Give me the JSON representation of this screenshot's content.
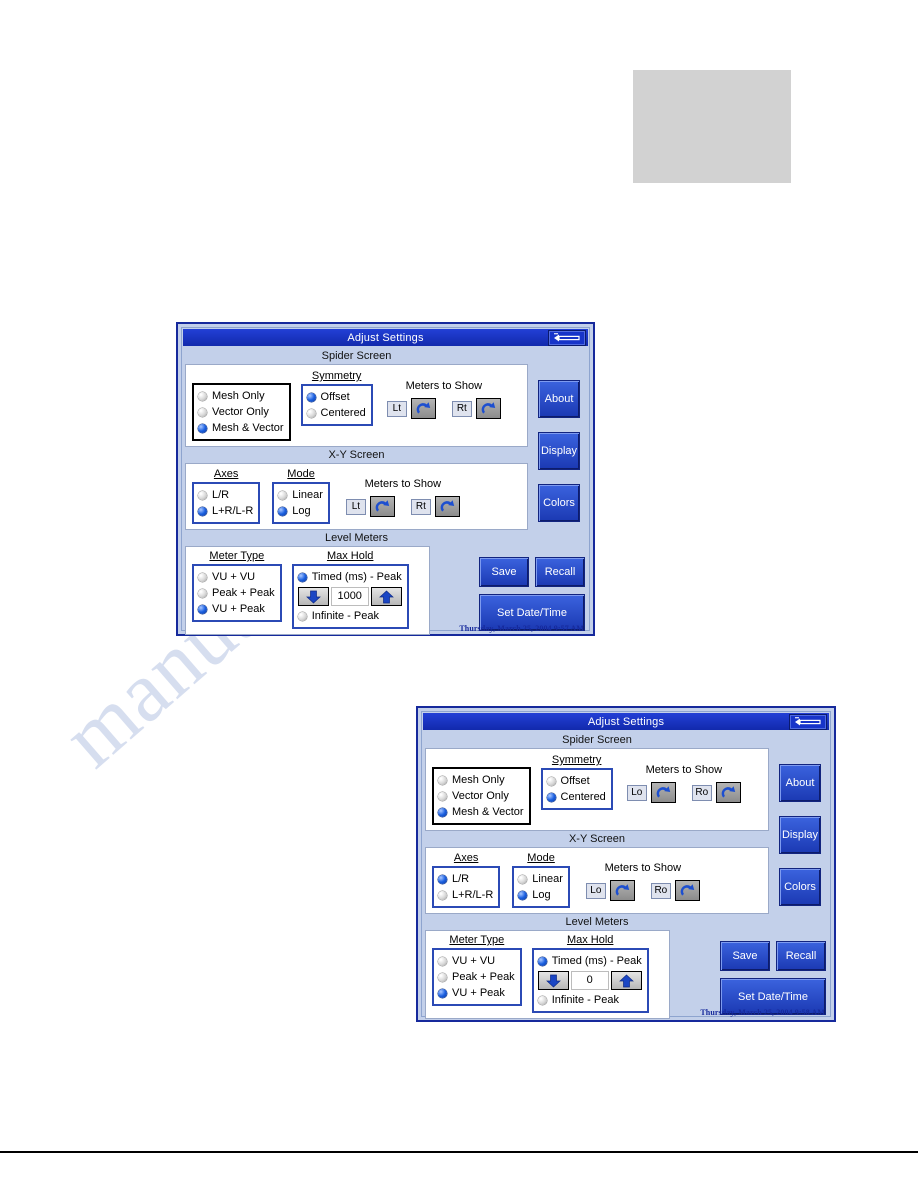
{
  "page": {
    "watermark_text": "manualshive.com"
  },
  "dialogs": [
    {
      "id": "dialog-1",
      "title": "Adjust Settings",
      "close_icon": "back-arrow-icon",
      "sections": {
        "spider": {
          "label": "Spider Screen",
          "display_group": {
            "options": [
              {
                "label": "Mesh Only",
                "selected": false
              },
              {
                "label": "Vector Only",
                "selected": false
              },
              {
                "label": "Mesh & Vector",
                "selected": true
              }
            ]
          },
          "symmetry_group": {
            "title": "Symmetry",
            "options": [
              {
                "label": "Offset",
                "selected": true
              },
              {
                "label": "Centered",
                "selected": false
              }
            ]
          },
          "meters": {
            "title": "Meters to Show",
            "left_label": "Lt",
            "right_label": "Rt"
          }
        },
        "xy": {
          "label": "X-Y Screen",
          "axes_group": {
            "title": "Axes",
            "options": [
              {
                "label": "L/R",
                "selected": false
              },
              {
                "label": "L+R/L-R",
                "selected": true
              }
            ]
          },
          "mode_group": {
            "title": "Mode",
            "options": [
              {
                "label": "Linear",
                "selected": false
              },
              {
                "label": "Log",
                "selected": true
              }
            ]
          },
          "meters": {
            "title": "Meters to Show",
            "left_label": "Lt",
            "right_label": "Rt"
          }
        },
        "level": {
          "label": "Level Meters",
          "meter_type_group": {
            "title": "Meter Type",
            "options": [
              {
                "label": "VU + VU",
                "selected": false
              },
              {
                "label": "Peak + Peak",
                "selected": false
              },
              {
                "label": "VU + Peak",
                "selected": true
              }
            ]
          },
          "max_hold_group": {
            "title": "Max Hold",
            "timed_label": "Timed (ms) - Peak",
            "timed_selected": true,
            "value": "1000",
            "infinite_label": "Infinite - Peak",
            "infinite_selected": false
          }
        }
      },
      "side_buttons": {
        "about": "About",
        "display": "Display",
        "colors": "Colors"
      },
      "action_buttons": {
        "save": "Save",
        "recall": "Recall",
        "set_datetime": "Set Date/Time"
      },
      "timestamp": "Thursday, March 25, 2004  9:57 AM"
    },
    {
      "id": "dialog-2",
      "title": "Adjust Settings",
      "close_icon": "back-arrow-icon",
      "sections": {
        "spider": {
          "label": "Spider Screen",
          "display_group": {
            "options": [
              {
                "label": "Mesh Only",
                "selected": false
              },
              {
                "label": "Vector Only",
                "selected": false
              },
              {
                "label": "Mesh & Vector",
                "selected": true
              }
            ]
          },
          "symmetry_group": {
            "title": "Symmetry",
            "options": [
              {
                "label": "Offset",
                "selected": false
              },
              {
                "label": "Centered",
                "selected": true
              }
            ]
          },
          "meters": {
            "title": "Meters to Show",
            "left_label": "Lo",
            "right_label": "Ro"
          }
        },
        "xy": {
          "label": "X-Y Screen",
          "axes_group": {
            "title": "Axes",
            "options": [
              {
                "label": "L/R",
                "selected": true
              },
              {
                "label": "L+R/L-R",
                "selected": false
              }
            ]
          },
          "mode_group": {
            "title": "Mode",
            "options": [
              {
                "label": "Linear",
                "selected": false
              },
              {
                "label": "Log",
                "selected": true
              }
            ]
          },
          "meters": {
            "title": "Meters to Show",
            "left_label": "Lo",
            "right_label": "Ro"
          }
        },
        "level": {
          "label": "Level Meters",
          "meter_type_group": {
            "title": "Meter Type",
            "options": [
              {
                "label": "VU + VU",
                "selected": false
              },
              {
                "label": "Peak + Peak",
                "selected": false
              },
              {
                "label": "VU + Peak",
                "selected": true
              }
            ]
          },
          "max_hold_group": {
            "title": "Max Hold",
            "timed_label": "Timed (ms) - Peak",
            "timed_selected": true,
            "value": "0",
            "infinite_label": "Infinite - Peak",
            "infinite_selected": false
          }
        }
      },
      "side_buttons": {
        "about": "About",
        "display": "Display",
        "colors": "Colors"
      },
      "action_buttons": {
        "save": "Save",
        "recall": "Recall",
        "set_datetime": "Set Date/Time"
      },
      "timestamp": "Thursday, March 25, 2004  9:58 AM"
    }
  ]
}
